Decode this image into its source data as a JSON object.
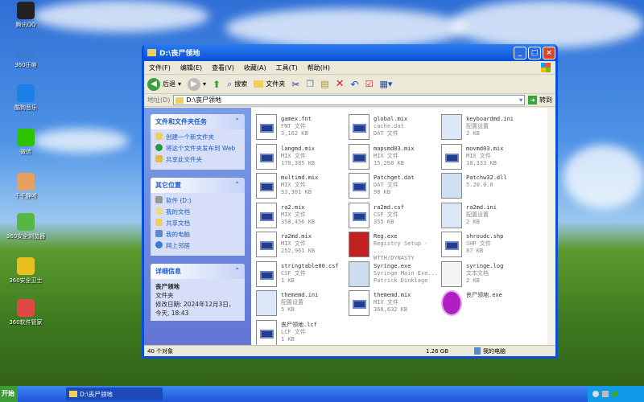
{
  "desktop": {
    "icons": [
      {
        "label": "腾讯QQ",
        "color": "#222"
      },
      {
        "label": "360压缩",
        "color": "#3a7bd5"
      },
      {
        "label": "酷狗音乐",
        "color": "#1b7fe8"
      },
      {
        "label": "微信",
        "color": "#2dc100"
      },
      {
        "label": "千千静听",
        "color": "#e8a060"
      },
      {
        "label": "360安全浏览器",
        "color": "#55b844"
      },
      {
        "label": "360安全卫士",
        "color": "#e8c020"
      },
      {
        "label": "360软件管家",
        "color": "#e04848"
      }
    ]
  },
  "window": {
    "title": "D:\\丧尸领地",
    "menu": [
      "文件(F)",
      "编辑(E)",
      "查看(V)",
      "收藏(A)",
      "工具(T)",
      "帮助(H)"
    ],
    "toolbar": {
      "back": "后退",
      "search": "搜索",
      "folders": "文件夹"
    },
    "address": {
      "label": "地址(D)",
      "value": "D:\\丧尸领地",
      "go": "转到"
    },
    "tasks": {
      "title": "文件和文件夹任务",
      "items": [
        "创建一个新文件夹",
        "将这个文件夹发布到 Web",
        "共享此文件夹"
      ]
    },
    "places": {
      "title": "其它位置",
      "items": [
        "软件 (D:)",
        "我的文档",
        "共享文档",
        "我的电脑",
        "网上邻居"
      ]
    },
    "details": {
      "title": "详细信息",
      "name": "丧尸领地",
      "type": "文件夹",
      "modified": "修改日期: 2024年12月3日，今天, 18:43"
    },
    "files": [
      {
        "name": "gamex.fnt",
        "type": "FNT 文件",
        "size": "3,162 KB",
        "icon": "generic"
      },
      {
        "name": "global.mix",
        "type": "cache.dat",
        "size": "DAT 文件",
        "icon": "generic"
      },
      {
        "name": "keyboardmd.ini",
        "type": "配置设置",
        "size": "2 KB",
        "icon": "ini"
      },
      {
        "name": "langmd.mix",
        "type": "MIX 文件",
        "size": "170,385 KB",
        "icon": "generic"
      },
      {
        "name": "mapsmd03.mix",
        "type": "MIX 文件",
        "size": "15,268 KB",
        "icon": "generic"
      },
      {
        "name": "movmd03.mix",
        "type": "MIX 文件",
        "size": "18,333 KB",
        "icon": "generic"
      },
      {
        "name": "multimd.mix",
        "type": "MIX 文件",
        "size": "33,301 KB",
        "icon": "generic"
      },
      {
        "name": "Patchget.dat",
        "type": "DAT 文件",
        "size": "98 KB",
        "icon": "generic"
      },
      {
        "name": "Patchw32.dll",
        "type": "5.20.0.0",
        "size": "",
        "icon": "dll"
      },
      {
        "name": "ra2.mix",
        "type": "MIX 文件",
        "size": "358,456 KB",
        "icon": "generic"
      },
      {
        "name": "ra2md.csf",
        "type": "CSF 文件",
        "size": "355 KB",
        "icon": "generic"
      },
      {
        "name": "ra2md.ini",
        "type": "配置设置",
        "size": "2 KB",
        "icon": "ini"
      },
      {
        "name": "ra2md.mix",
        "type": "MIX 文件",
        "size": "252,961 KB",
        "icon": "generic"
      },
      {
        "name": "Reg.exe",
        "type": "Registry Setup - ...",
        "size": "WTTH/DYNASTY",
        "icon": "reg"
      },
      {
        "name": "shroudc.shp",
        "type": "SHP 文件",
        "size": "87 KB",
        "icon": "generic"
      },
      {
        "name": "stringtable00.csf",
        "type": "CSF 文件",
        "size": "1 KB",
        "icon": "generic"
      },
      {
        "name": "Syringe.exe",
        "type": "Syringe Main Exe...",
        "size": "Patrick Dinklage",
        "icon": "syringe"
      },
      {
        "name": "syringe.log",
        "type": "文本文档",
        "size": "2 KB",
        "icon": "text"
      },
      {
        "name": "thememd.ini",
        "type": "配置设置",
        "size": "5 KB",
        "icon": "ini"
      },
      {
        "name": "thememd.mix",
        "type": "MIX 文件",
        "size": "366,632 KB",
        "icon": "generic"
      },
      {
        "name": "丧尸领地.exe",
        "type": "",
        "size": "",
        "icon": "biohazard"
      },
      {
        "name": "丧尸领地.lcf",
        "type": "LCF 文件",
        "size": "1 KB",
        "icon": "generic"
      }
    ],
    "status": {
      "count": "40 个对象",
      "size": "1.26 GB",
      "location": "我的电脑"
    }
  },
  "taskbar": {
    "start": "开始",
    "task": "D:\\丧尸领地"
  }
}
